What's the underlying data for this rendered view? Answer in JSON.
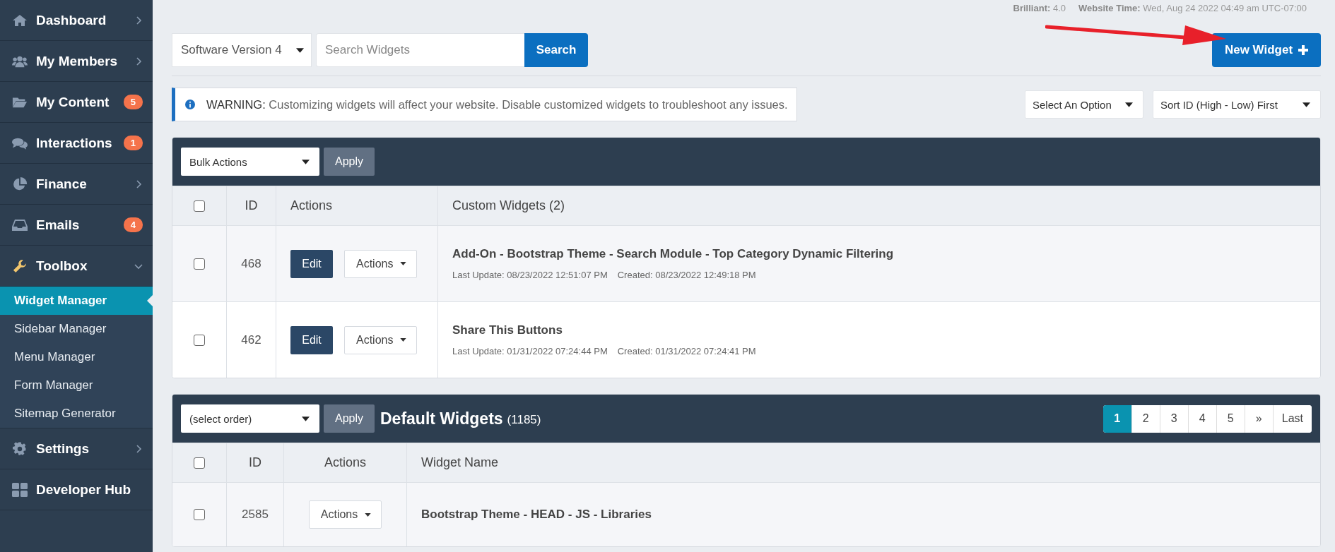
{
  "sidebar": {
    "items": [
      {
        "label": "Dashboard",
        "kind": "menu",
        "expanded": false
      },
      {
        "label": "My Members",
        "kind": "menu",
        "expanded": false
      },
      {
        "label": "My Content",
        "kind": "badge",
        "badge": "5"
      },
      {
        "label": "Interactions",
        "kind": "badge",
        "badge": "1"
      },
      {
        "label": "Finance",
        "kind": "menu",
        "expanded": false
      },
      {
        "label": "Emails",
        "kind": "badge",
        "badge": "4"
      },
      {
        "label": "Toolbox",
        "kind": "menu",
        "expanded": true,
        "children": [
          {
            "label": "Widget Manager",
            "selected": true
          },
          {
            "label": "Sidebar Manager",
            "selected": false
          },
          {
            "label": "Menu Manager",
            "selected": false
          },
          {
            "label": "Form Manager",
            "selected": false
          },
          {
            "label": "Sitemap Generator",
            "selected": false
          }
        ]
      },
      {
        "label": "Settings",
        "kind": "menu",
        "expanded": false
      },
      {
        "label": "Developer Hub",
        "kind": "plain"
      }
    ]
  },
  "top_info": [
    {
      "label": "Brilliant:",
      "value": "4.0"
    },
    {
      "label": "Website Time:",
      "value": "Wed, Aug 24 2022 04:49 am UTC-07:00"
    }
  ],
  "toolbar": {
    "version_select": "Software Version 4",
    "search": {
      "placeholder": "Search Widgets"
    },
    "search_button": "Search",
    "new_button": "New Widget"
  },
  "warning": "**WARNING:** Customizing widgets will affect your website. Disable customized widgets to troubleshoot any issues.",
  "filters": [
    "Select An Option",
    "Sort ID (High - Low) First"
  ],
  "custom_table": {
    "bulk_select": "Bulk Actions",
    "apply": "Apply",
    "header_checked": false,
    "columns": [
      "ID",
      "Actions",
      "Custom Widgets (2)"
    ],
    "rows": [
      {
        "checked": false,
        "id": "468",
        "edit": "Edit",
        "actions": "Actions",
        "name": "Add-On - Bootstrap Theme - Search Module - Top Category Dynamic Filtering",
        "updated": "Last Update: 08/23/2022 12:51:07 PM",
        "created": "Created: 08/23/2022 12:49:18 PM"
      },
      {
        "checked": false,
        "id": "462",
        "edit": "Edit",
        "actions": "Actions",
        "name": "Share This Buttons",
        "updated": "Last Update: 01/31/2022 07:24:44 PM",
        "created": "Created: 01/31/2022 07:24:41 PM"
      }
    ]
  },
  "default_table": {
    "order_select": "(select order)",
    "apply": "Apply",
    "title": "Default Widgets",
    "count": "(1185)",
    "pages": [
      {
        "label": "1",
        "selected": true
      },
      {
        "label": "2",
        "selected": false
      },
      {
        "label": "3",
        "selected": false
      },
      {
        "label": "4",
        "selected": false
      },
      {
        "label": "5",
        "selected": false
      },
      {
        "label": "»",
        "selected": false
      },
      {
        "label": "Last",
        "selected": false
      }
    ],
    "header_checked": false,
    "columns": [
      "ID",
      "Actions",
      "Widget Name"
    ],
    "rows": [
      {
        "checked": false,
        "id": "2585",
        "actions": "Actions",
        "name": "Bootstrap Theme - HEAD - JS - Libraries"
      }
    ]
  }
}
